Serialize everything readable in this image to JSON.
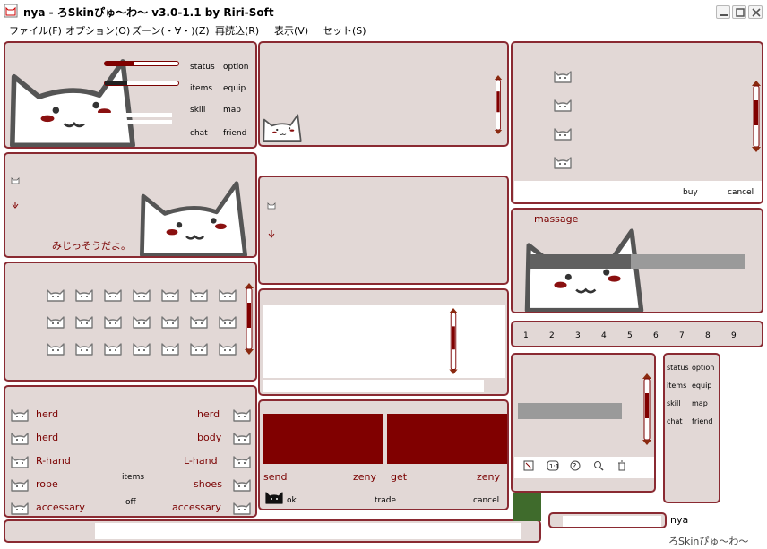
{
  "window": {
    "title": "nya - ろSkinぴゅ～わ～ v3.0-1.1 by Riri-Soft",
    "minimize": "–",
    "maximize": "□",
    "close": "×"
  },
  "menu": [
    {
      "label": "ファイル(F)"
    },
    {
      "label": "オプション(O)"
    },
    {
      "label": "ズーン(・∀・)(Z)"
    },
    {
      "label": "再読込(R)"
    },
    {
      "label": "表示(V)"
    },
    {
      "label": "セット(S)"
    }
  ],
  "status": {
    "buttons": [
      "status",
      "option",
      "items",
      "equip",
      "skill",
      "map",
      "chat",
      "friend"
    ]
  },
  "chat": {
    "caption": "みじっそうだよ。"
  },
  "equipment": {
    "left": [
      "herd",
      "herd",
      "R-hand",
      "robe",
      "accessary"
    ],
    "right": [
      "herd",
      "body",
      "L-hand",
      "shoes",
      "accessary"
    ],
    "items_button": "items",
    "off_button": "off"
  },
  "trade": {
    "send": "send",
    "zeny_left": "zeny",
    "get": "get",
    "zeny_right": "zeny",
    "ok": "ok",
    "trade": "trade",
    "cancel": "cancel"
  },
  "shop": {
    "buy": "buy",
    "cancel": "cancel"
  },
  "message": {
    "title": "massage"
  },
  "hotkeys": [
    "1",
    "2",
    "3",
    "4",
    "5",
    "6",
    "7",
    "8",
    "9"
  ],
  "mini_status": {
    "buttons": [
      "status",
      "option",
      "items",
      "equip",
      "skill",
      "map",
      "chat",
      "friend"
    ]
  },
  "toolbar": {
    "icons": [
      "resize-icon",
      "one-to-one-icon",
      "help-icon",
      "magnifier-icon",
      "trash-icon"
    ]
  },
  "player": {
    "name": "nya"
  },
  "footer": {
    "watermark": "ろSkinぴゅ～わ～"
  },
  "colors": {
    "frame": "#8a2a32",
    "panel": "#e2d8d6",
    "accent": "#800000"
  }
}
